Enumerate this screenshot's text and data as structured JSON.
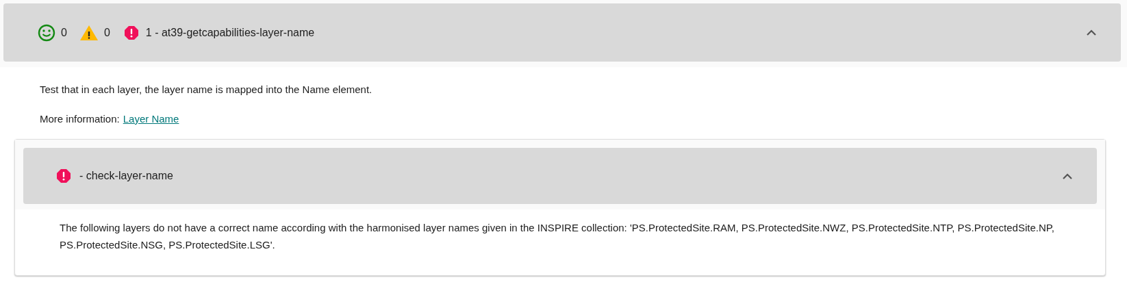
{
  "test_case": {
    "expanded": true,
    "passed_count": "0",
    "warning_count": "0",
    "error_label": "1 - at39-getcapabilities-layer-name",
    "description": "Test that in each layer, the layer name is mapped into the Name element.",
    "more_info_label": "More information:",
    "more_info_link": "Layer Name",
    "assertion": {
      "expanded": true,
      "label": "- check-layer-name",
      "message": "The following layers do not have a correct name according with the harmonised layer names given in the INSPIRE collection: 'PS.ProtectedSite.RAM, PS.ProtectedSite.NWZ, PS.ProtectedSite.NTP, PS.ProtectedSite.NP, PS.ProtectedSite.NSG, PS.ProtectedSite.LSG'."
    }
  }
}
